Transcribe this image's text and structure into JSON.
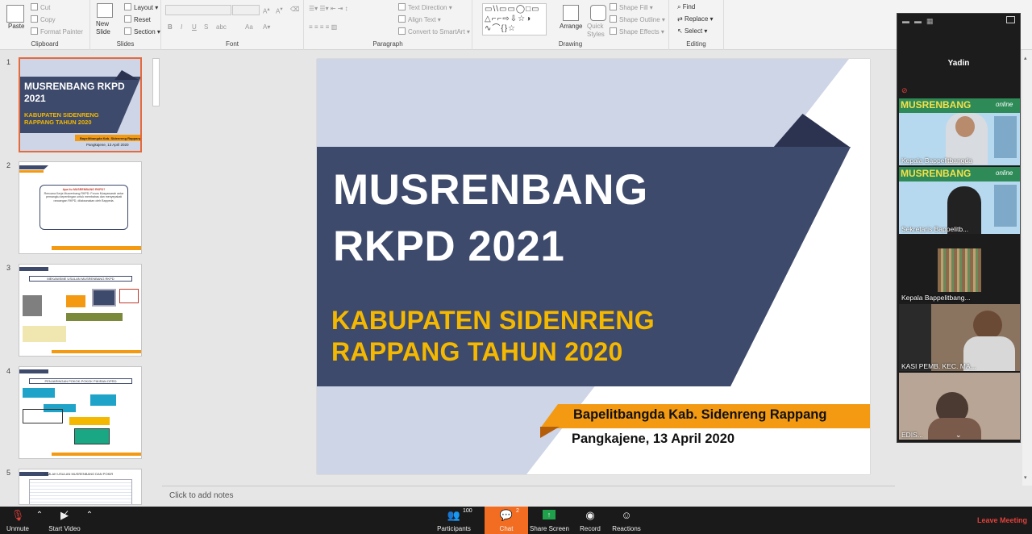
{
  "ribbon": {
    "clipboard": {
      "paste": "Paste",
      "cut": "Cut",
      "copy": "Copy",
      "format_painter": "Format Painter",
      "label": "Clipboard"
    },
    "slides": {
      "new_slide": "New Slide",
      "layout": "Layout",
      "reset": "Reset",
      "section": "Section",
      "label": "Slides"
    },
    "font": {
      "bold": "B",
      "italic": "I",
      "underline": "U",
      "strike": "S",
      "spacing": "abc",
      "case": "Aa",
      "label": "Font"
    },
    "paragraph": {
      "text_direction": "Text Direction",
      "align_text": "Align Text",
      "convert_smartart": "Convert to SmartArt",
      "label": "Paragraph"
    },
    "drawing": {
      "arrange": "Arrange",
      "quick_styles": "Quick Styles",
      "shape_fill": "Shape Fill",
      "shape_outline": "Shape Outline",
      "shape_effects": "Shape Effects",
      "label": "Drawing"
    },
    "editing": {
      "find": "Find",
      "replace": "Replace",
      "select": "Select",
      "label": "Editing"
    }
  },
  "thumbnails": [
    {
      "num": "1",
      "title": "MUSRENBANG RKPD 2021",
      "subtitle": "KABUPATEN SIDENRENG RAPPANG TAHUN 2020",
      "footer": "Bapelitbangda Kab. Sidenreng Rappang",
      "date": "Pangkajene, 13 April 2020"
    },
    {
      "num": "2",
      "q": "Apa itu MUSRENBANG RKPD?",
      "a": "Rencana Kerja Musrenbang RKPD: Forum Musyawarah antar pemangku kepentingan untuk membahas dan menyepakati rancangan RKPD, dilaksanakan oleh Bappeda."
    },
    {
      "num": "3",
      "title": "MEKANISME USULAN MUSRENBANG RKPD"
    },
    {
      "num": "4",
      "title": "PENJARINGAN POKOK-POKOK PIKIRAN DPRD"
    },
    {
      "num": "5",
      "title": "JUMLAH USULAN MUSRENBANG DAN POKIR"
    }
  ],
  "slide": {
    "title_line1": "MUSRENBANG",
    "title_line2": "RKPD 2021",
    "subtitle_line1": "KABUPATEN SIDENRENG",
    "subtitle_line2": "RAPPANG TAHUN 2020",
    "org": "Bapelitbangda Kab. Sidenreng Rappang",
    "date": "Pangkajene, 13 April 2020"
  },
  "notes_placeholder": "Click to add notes",
  "zoom_panel": {
    "speaker": "Yadin",
    "tiles": [
      {
        "name": "Kepala Bappelitbangda",
        "banner": "MUSRENBANG",
        "tag": "online"
      },
      {
        "name": "Sekretaris Bappelitb...",
        "banner": "MUSRENBANG",
        "tag": "online"
      },
      {
        "name": "Kepala Bappelitbang..."
      },
      {
        "name": "KASI PEMB. KEC. MA..."
      },
      {
        "name": "EDIS..."
      }
    ]
  },
  "zoom_bar": {
    "unmute": "Unmute",
    "start_video": "Start Video",
    "participants": "Participants",
    "participants_count": "100",
    "chat": "Chat",
    "chat_count": "2",
    "share_screen": "Share Screen",
    "record": "Record",
    "reactions": "Reactions",
    "leave": "Leave Meeting"
  },
  "colors": {
    "navy": "#3d4a6b",
    "light_blue": "#cdd5e6",
    "yellow": "#f5b800",
    "orange": "#f39a12",
    "dark_navy": "#2b3350",
    "zoom_orange": "#f26d21",
    "zoom_red": "#e0413a"
  }
}
